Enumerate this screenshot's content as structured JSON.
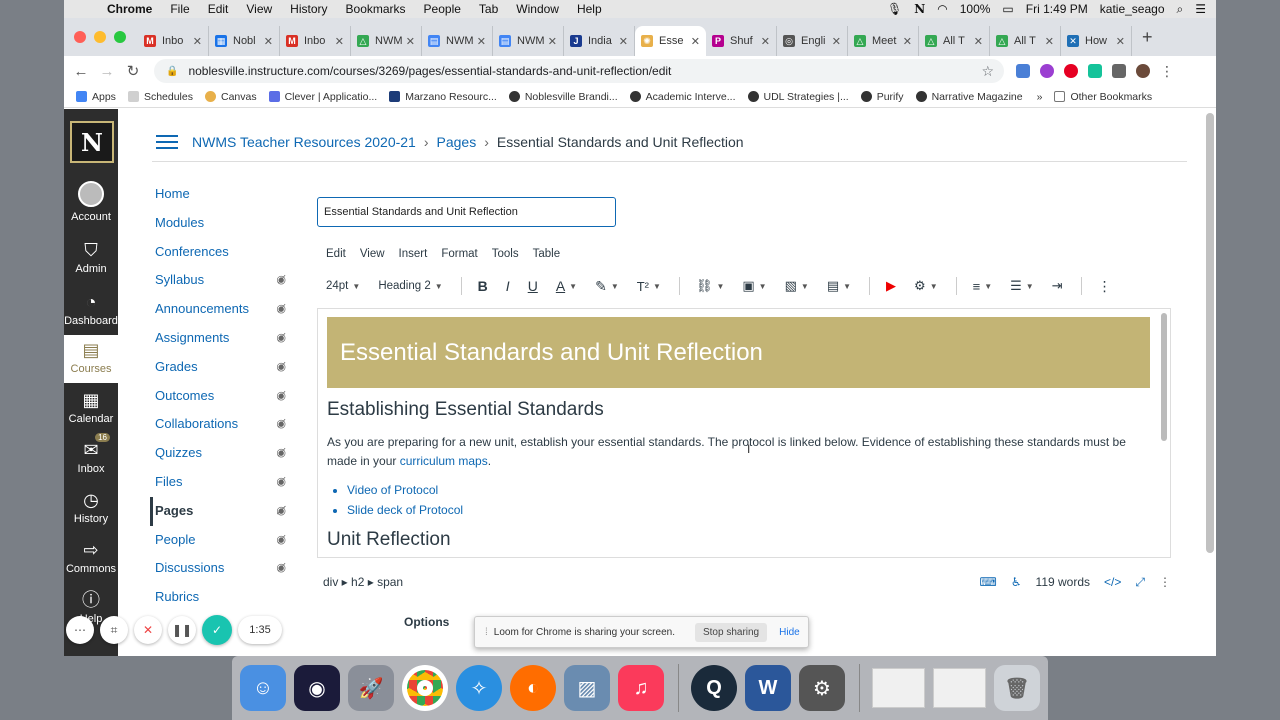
{
  "menubar": {
    "items": [
      "Chrome",
      "File",
      "Edit",
      "View",
      "History",
      "Bookmarks",
      "People",
      "Tab",
      "Window",
      "Help"
    ],
    "battery": "100%",
    "time": "Fri 1:49 PM",
    "user": "katie_seago"
  },
  "tabs": [
    {
      "label": "Inbo",
      "color": "#d93025",
      "glyph": "M"
    },
    {
      "label": "Nobl",
      "color": "#1a73e8",
      "glyph": "▦"
    },
    {
      "label": "Inbo",
      "color": "#d93025",
      "glyph": "M"
    },
    {
      "label": "NWM",
      "color": "#34a853",
      "glyph": "△"
    },
    {
      "label": "NWM",
      "color": "#4285f4",
      "glyph": "▤"
    },
    {
      "label": "NWM",
      "color": "#4285f4",
      "glyph": "▤"
    },
    {
      "label": "India",
      "color": "#1a3b8f",
      "glyph": "J"
    },
    {
      "label": "Esse",
      "color": "#e8b04a",
      "glyph": "✺"
    },
    {
      "label": "Shuf",
      "color": "#b5008f",
      "glyph": "P"
    },
    {
      "label": "Engli",
      "color": "#555555",
      "glyph": "◎"
    },
    {
      "label": "Meet",
      "color": "#34a853",
      "glyph": "△"
    },
    {
      "label": "All T",
      "color": "#34a853",
      "glyph": "△"
    },
    {
      "label": "All T",
      "color": "#34a853",
      "glyph": "△"
    },
    {
      "label": "How",
      "color": "#1f6fb5",
      "glyph": "✕"
    }
  ],
  "url": "noblesville.instructure.com/courses/3269/pages/essential-standards-and-unit-reflection/edit",
  "bookmarks": [
    "Apps",
    "Schedules",
    "Canvas",
    "Clever | Applicatio...",
    "Marzano Resourc...",
    "Noblesville Brandi...",
    "Academic Interve...",
    "UDL Strategies |...",
    "Purify",
    "Narrative Magazine"
  ],
  "other_bookmarks": "Other Bookmarks",
  "globalnav": {
    "logo": "N",
    "items": [
      "Account",
      "Admin",
      "Dashboard",
      "Courses",
      "Calendar",
      "Inbox",
      "History",
      "Commons",
      "Help"
    ],
    "inbox_badge": "16"
  },
  "breadcrumb": {
    "course": "NWMS Teacher Resources 2020-21",
    "section": "Pages",
    "current": "Essential Standards and Unit Reflection"
  },
  "coursenav": [
    "Home",
    "Modules",
    "Conferences",
    "Syllabus",
    "Announcements",
    "Assignments",
    "Grades",
    "Outcomes",
    "Collaborations",
    "Quizzes",
    "Files",
    "Pages",
    "People",
    "Discussions",
    "Rubrics"
  ],
  "title_input": "Essential Standards and Unit Reflection",
  "rce_menu": [
    "Edit",
    "View",
    "Insert",
    "Format",
    "Tools",
    "Table"
  ],
  "rce_toolbar": {
    "font_size": "24pt",
    "block": "Heading 2"
  },
  "content": {
    "banner": "Essential Standards and Unit Reflection",
    "h2a": "Establishing Essential Standards",
    "para": "As you are preparing for a new unit, establish your essential standards.  The protocol is linked below.  Evidence of establishing these standards must be made in your ",
    "para_link": "curriculum maps",
    "para_end": ".",
    "links": [
      "Video of Protocol",
      "Slide deck of Protocol"
    ],
    "h2b": "Unit Reflection"
  },
  "statusbar": {
    "path": "div ▸ h2 ▸ span",
    "words": "119 words",
    "html": "</>"
  },
  "options_label": "Options",
  "loom": {
    "message": "Loom for Chrome is sharing your screen.",
    "stop": "Stop sharing",
    "hide": "Hide",
    "timer": "1:35"
  }
}
